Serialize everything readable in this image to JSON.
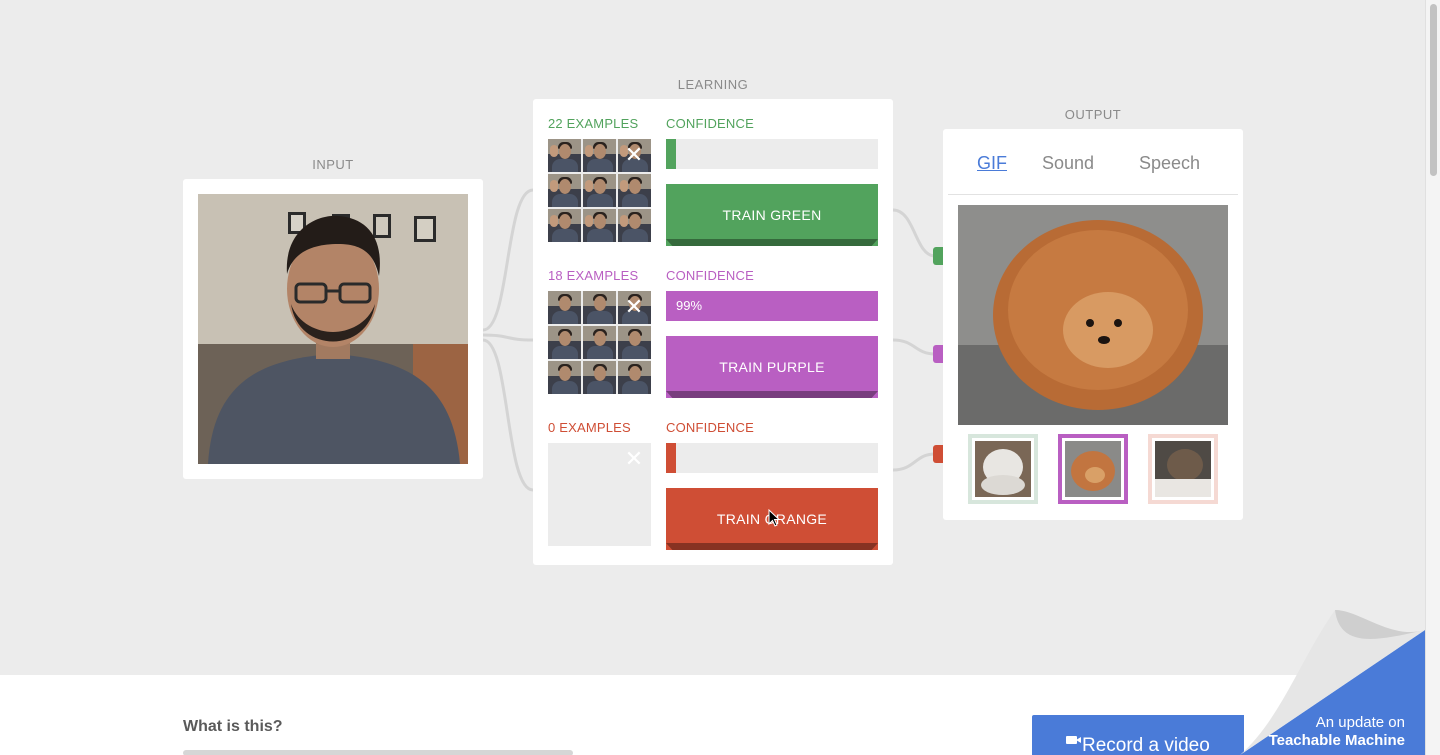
{
  "sections": {
    "input": "INPUT",
    "learning": "LEARNING",
    "output": "OUTPUT"
  },
  "classes": [
    {
      "count": "22 EXAMPLES",
      "confidence_label": "CONFIDENCE",
      "confidence_value": "",
      "confidence_fraction": 0,
      "train_label": "TRAIN GREEN",
      "color": "#52a35d",
      "dark": "#3a7a44"
    },
    {
      "count": "18 EXAMPLES",
      "confidence_label": "CONFIDENCE",
      "confidence_value": "99%",
      "confidence_fraction": 1.0,
      "train_label": "TRAIN PURPLE",
      "color": "#b95fc2",
      "dark": "#8a3f93"
    },
    {
      "count": "0 EXAMPLES",
      "confidence_label": "CONFIDENCE",
      "confidence_value": "",
      "confidence_fraction": 0,
      "train_label": "TRAIN ORANGE",
      "color": "#cf4e35",
      "dark": "#a23a25"
    }
  ],
  "output": {
    "tabs": [
      "GIF",
      "Sound",
      "Speech"
    ],
    "active_tab": "GIF"
  },
  "bottom": {
    "heading": "What is this?",
    "record_button": "Record a video",
    "update_line1": "An update on",
    "update_line2": "Teachable Machine"
  },
  "colors": {
    "accent_blue": "#4a7bd8",
    "background": "#ececec"
  }
}
